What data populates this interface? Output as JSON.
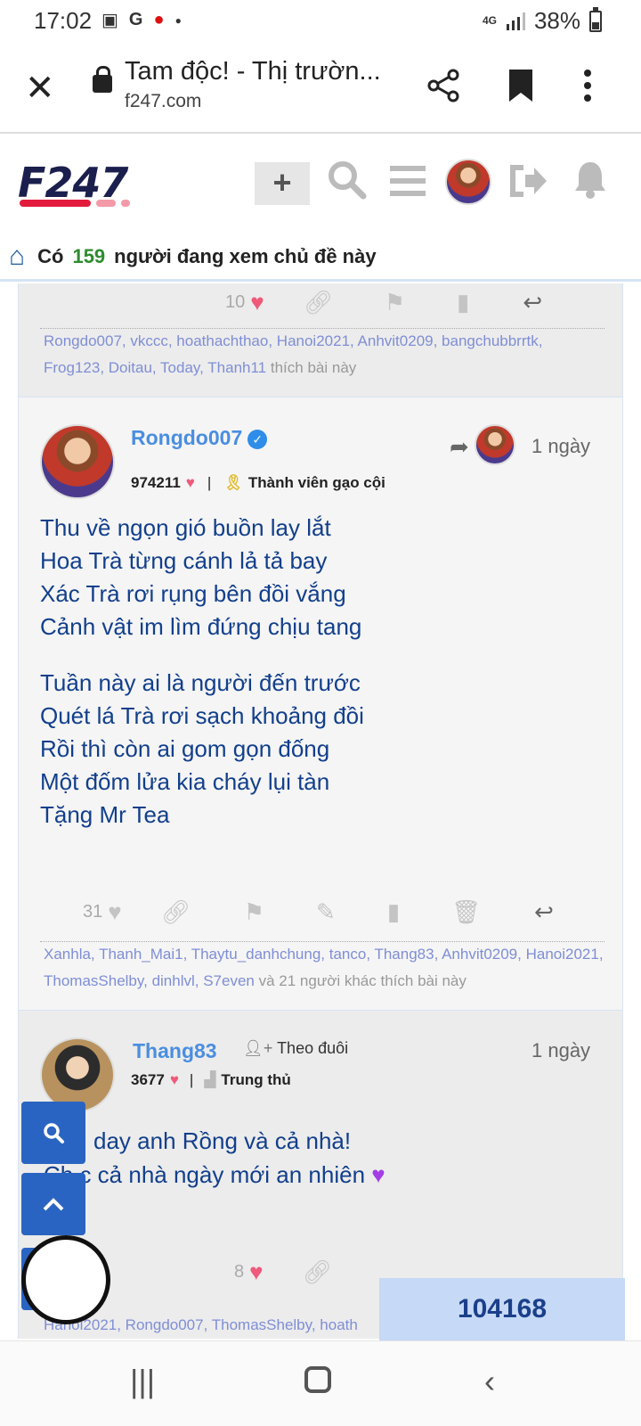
{
  "status_bar": {
    "time": "17:02",
    "network": "4G",
    "battery": "38%",
    "icons": [
      "image-icon",
      "g-icon",
      "record-icon",
      "dot-icon"
    ]
  },
  "browser": {
    "title": "Tam độc! - Thị trườn...",
    "domain": "f247.com"
  },
  "site": {
    "logo": "F247",
    "brand_colors": [
      "#1b1f4d",
      "#e31c3d",
      "#f29aa8"
    ]
  },
  "viewers": {
    "prefix": "Có",
    "count": "159",
    "suffix": "người đang xem chủ đề này"
  },
  "post_prev": {
    "like_count": "10",
    "likers": "Rongdo007, vkccc, hoathachthao, Hanoi2021, Anhvit0209, bangchubbrrtk, Frog123, Doitau, Today, Thanh11",
    "likers_suffix": "thích bài này"
  },
  "post_main": {
    "username": "Rongdo007",
    "points": "974211",
    "rank": "Thành viên gạo cội",
    "time": "1 ngày",
    "lines": [
      "Thu về ngọn gió buồn lay lắt",
      "Hoa Trà từng cánh lả tả bay",
      "Xác Trà rơi rụng bên đồi vắng",
      "Cảnh vật im lìm đứng chịu tang",
      "Tuần này ai là người đến trước",
      "Quét lá Trà rơi sạch khoảng đồi",
      "Rồi thì còn ai gom gọn đống",
      "Một đốm lửa kia cháy lụi tàn",
      "Tặng Mr Tea"
    ],
    "like_count": "31",
    "likers": "Xanhla, Thanh_Mai1, Thaytu_danhchung, tanco, Thang83, Anhvit0209, Hanoi2021, ThomasShelby, dinhlvl, S7even",
    "likers_suffix": "và 21 người khác thích bài này"
  },
  "post_next": {
    "username": "Thang83",
    "follow_label": "Theo đuôi",
    "points": "3677",
    "rank": "Trung thủ",
    "time": "1 ngày",
    "line1": "day anh Rồng và cả nhà!",
    "line2": "Ch   c cả nhà ngày mới an nhiên",
    "like_count": "8",
    "likers": "Hanoi2021, Rongdo007, ThomasShelby, hoath"
  },
  "counter": "104168"
}
